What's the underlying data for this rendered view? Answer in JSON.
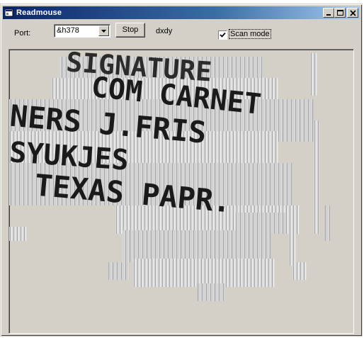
{
  "window": {
    "title": "Readmouse",
    "icon": "app-icon"
  },
  "titlebar_buttons": {
    "minimize": "minimize-icon",
    "maximize": "maximize-icon",
    "close": "close-icon"
  },
  "toolbar": {
    "port_label": "Port:",
    "port_value": "&h378",
    "stop_label": "Stop",
    "dxdy_label": "dxdy",
    "scan_mode_label": "Scan mode",
    "scan_mode_checked": true
  },
  "scan_image": {
    "text_lines": [
      "SIGNATURE",
      "COM CARNET",
      "NERS J.FRIS",
      "SYUKJES",
      "TEXAS PAPR."
    ]
  }
}
